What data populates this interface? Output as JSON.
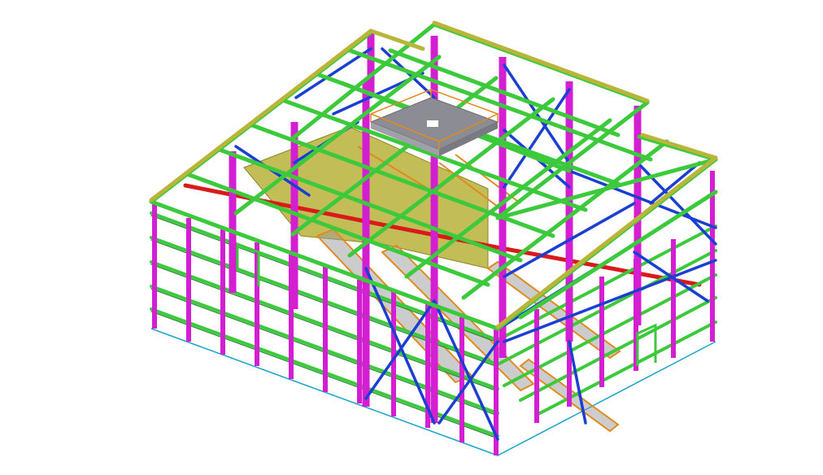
{
  "viewer": {
    "background": "#ffffff",
    "model_kind": "3D steel structure model (isometric view)"
  },
  "member_colors": {
    "columns": "#d41ed2",
    "beams": "#3cc93c",
    "beam_edges": "#1f8a2c",
    "bracing": "#1a3fd1",
    "roof_edge": "#b9b53a",
    "crane_rail": "#d81a1a",
    "floor_plate": "#b9b23a",
    "stairs_handrail": "#e08a1e",
    "top_platform": "#8c8c94",
    "girts": "#5aa83a",
    "base_line": "#1aa3c9"
  },
  "legend_items": []
}
